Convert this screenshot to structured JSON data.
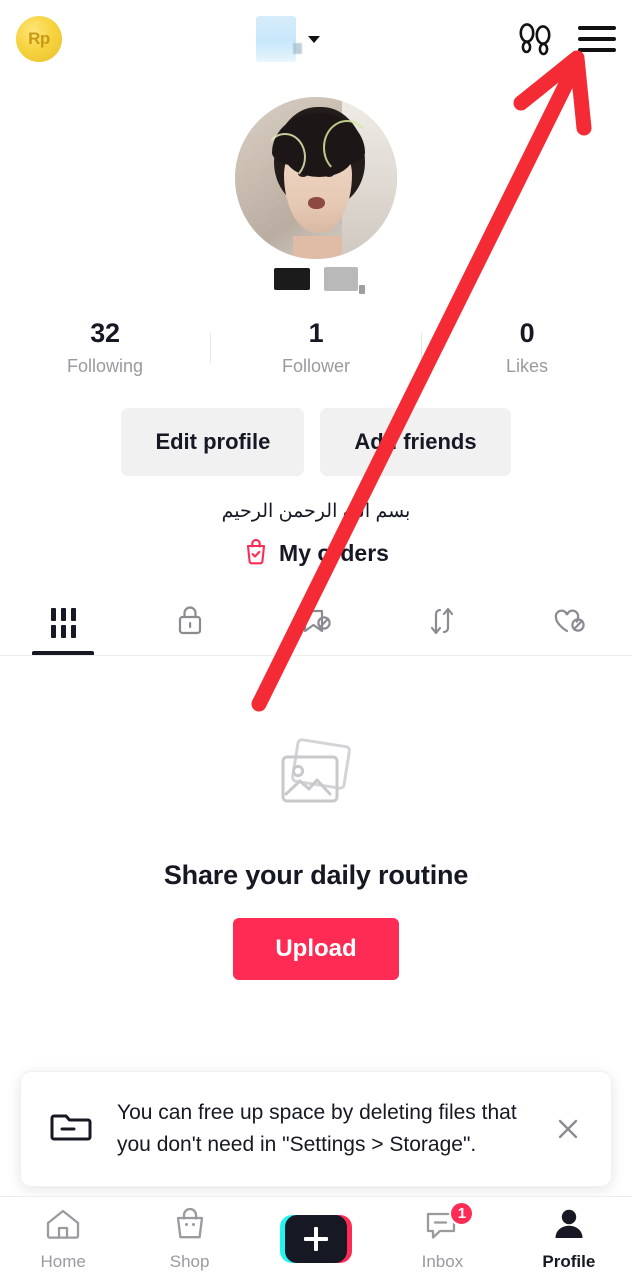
{
  "header": {
    "coin_label": "Rp",
    "coin_icon": "rupiah-coin-icon",
    "username_redacted": true,
    "dropdown_icon": "chevron-down-icon",
    "footprints_icon": "footprints-icon",
    "menu_icon": "hamburger-menu-icon"
  },
  "profile": {
    "avatar_icon": "profile-avatar",
    "handle_redacted": true,
    "stats": [
      {
        "value": "32",
        "label": "Following"
      },
      {
        "value": "1",
        "label": "Follower"
      },
      {
        "value": "0",
        "label": "Likes"
      }
    ],
    "buttons": [
      {
        "label": "Edit profile"
      },
      {
        "label": "Add friends"
      }
    ],
    "bio": "بسم الله الرحمن الرحيم",
    "orders": {
      "label": "My orders",
      "icon": "shopping-bag-check-icon",
      "color": "#FE2C55"
    }
  },
  "tabs": [
    {
      "name": "videos",
      "icon": "grid-icon",
      "active": true
    },
    {
      "name": "private",
      "icon": "lock-icon",
      "active": false
    },
    {
      "name": "saved",
      "icon": "bookmark-hidden-icon",
      "active": false
    },
    {
      "name": "reposts",
      "icon": "repost-icon",
      "active": false
    },
    {
      "name": "liked",
      "icon": "heart-hidden-icon",
      "active": false
    }
  ],
  "empty_state": {
    "icon": "photos-placeholder-icon",
    "title": "Share your daily routine",
    "button_label": "Upload",
    "button_color": "#FE2C55"
  },
  "toast": {
    "icon": "folder-minus-icon",
    "message": "You can free up space by deleting files that you don't need in \"Settings > Storage\".",
    "close_icon": "close-icon"
  },
  "bottom_nav": [
    {
      "label": "Home",
      "icon": "home-icon",
      "active": false
    },
    {
      "label": "Shop",
      "icon": "shop-bag-icon",
      "active": false
    },
    {
      "label": "",
      "icon": "create-plus-icon",
      "active": false
    },
    {
      "label": "Inbox",
      "icon": "inbox-bubble-icon",
      "active": false,
      "badge": "1"
    },
    {
      "label": "Profile",
      "icon": "person-icon",
      "active": true
    }
  ],
  "annotation": {
    "type": "arrow",
    "color": "#F42B35",
    "points_to": "hamburger-menu-icon"
  }
}
